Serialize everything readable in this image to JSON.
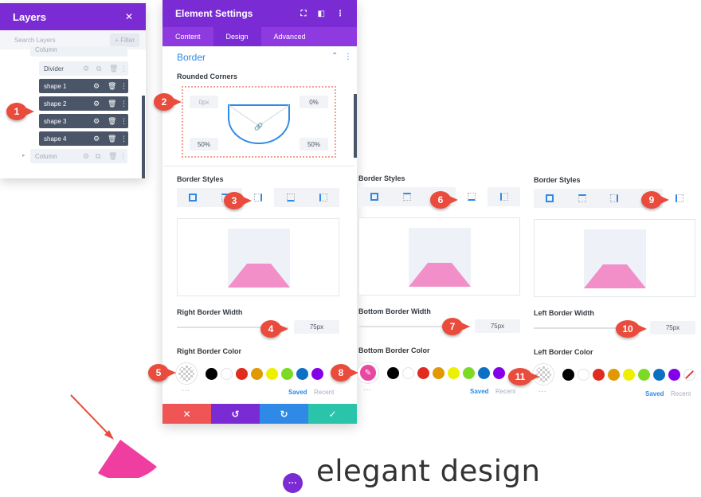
{
  "layers": {
    "title": "Layers",
    "close": "✕",
    "search_placeholder": "Search Layers",
    "filter": "+ Filter",
    "rows": [
      "Column",
      "Divider",
      "shape 1",
      "shape 2",
      "shape 3",
      "shape 4",
      "Column"
    ]
  },
  "settings": {
    "title": "Element Settings",
    "tabs": [
      "Content",
      "Design",
      "Advanced"
    ],
    "section": "Border",
    "rounded_label": "Rounded Corners",
    "corners": [
      "0px",
      "0%",
      "50%",
      "50%"
    ]
  },
  "columns": [
    {
      "styles_label": "Border Styles",
      "width_label": "Right Border Width",
      "width_value": "75px",
      "color_label": "Right Border Color",
      "saved": "Saved",
      "recent": "Recent"
    },
    {
      "styles_label": "Border Styles",
      "width_label": "Bottom Border Width",
      "width_value": "75px",
      "color_label": "Bottom Border Color",
      "saved": "Saved",
      "recent": "Recent"
    },
    {
      "styles_label": "Border Styles",
      "width_label": "Left Border Width",
      "width_value": "75px",
      "color_label": "Left Border Color",
      "saved": "Saved",
      "recent": "Recent"
    }
  ],
  "badges": [
    "1",
    "2",
    "3",
    "4",
    "5",
    "6",
    "7",
    "8",
    "9",
    "10",
    "11"
  ],
  "swatch_colors": [
    "#000000",
    "#ffffff",
    "#e02b20",
    "#e09900",
    "#edf000",
    "#7cda24",
    "#0c71c3",
    "#8300e9"
  ],
  "accent": "#7b2bd4",
  "footer": {
    "cancel": "✕",
    "undo": "↺",
    "redo": "↻",
    "save": "✓"
  },
  "bottom": {
    "text": "elegant design",
    "dots": "···"
  }
}
